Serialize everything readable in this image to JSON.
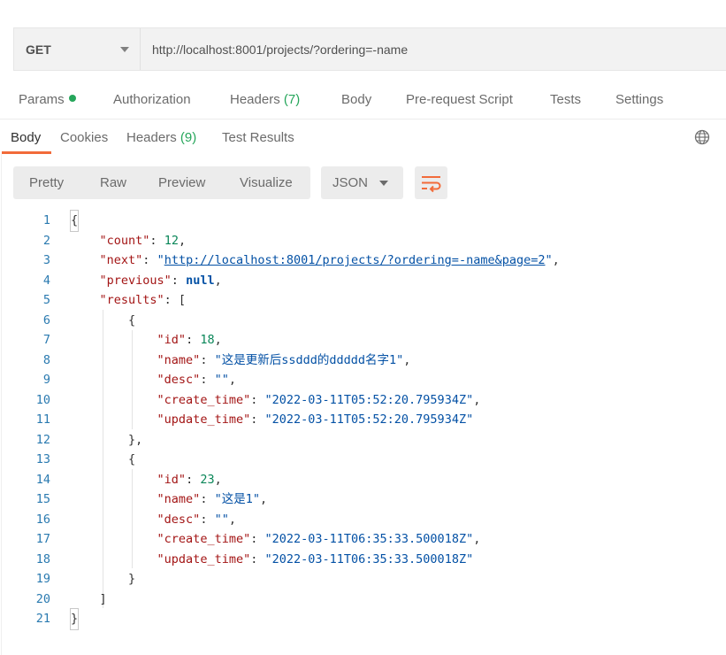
{
  "request": {
    "method": "GET",
    "url": "http://localhost:8001/projects/?ordering=-name"
  },
  "request_tabs": [
    {
      "label": "Params"
    },
    {
      "label": "Authorization"
    },
    {
      "label": "Headers",
      "count": "(7)"
    },
    {
      "label": "Body"
    },
    {
      "label": "Pre-request Script"
    },
    {
      "label": "Tests"
    },
    {
      "label": "Settings"
    }
  ],
  "response_tabs": [
    {
      "label": "Body"
    },
    {
      "label": "Cookies"
    },
    {
      "label": "Headers",
      "count": "(9)"
    },
    {
      "label": "Test Results"
    }
  ],
  "view_modes": [
    "Pretty",
    "Raw",
    "Preview",
    "Visualize"
  ],
  "format": "JSON",
  "icons": {
    "globe": "globe-icon",
    "wrap": "wrap-lines-icon"
  },
  "colors": {
    "accent": "#f26b3a",
    "count_green": "#26a65b",
    "line_number": "#2a7ab0",
    "json_key": "#a31515",
    "json_string": "#0451a5",
    "json_number": "#098658"
  },
  "response_body": {
    "count": "12",
    "next": "http://localhost:8001/projects/?ordering=-name&page=2",
    "previous": "null",
    "results": [
      {
        "id": "18",
        "name": "这是更新后ssddd的ddddd名字1",
        "desc": "",
        "create_time": "2022-03-11T05:52:20.795934Z",
        "update_time": "2022-03-11T05:52:20.795934Z"
      },
      {
        "id": "23",
        "name": "这是1",
        "desc": "",
        "create_time": "2022-03-11T06:35:33.500018Z",
        "update_time": "2022-03-11T06:35:33.500018Z"
      }
    ]
  },
  "line_numbers": [
    "1",
    "2",
    "3",
    "4",
    "5",
    "6",
    "7",
    "8",
    "9",
    "10",
    "11",
    "12",
    "13",
    "14",
    "15",
    "16",
    "17",
    "18",
    "19",
    "20",
    "21"
  ]
}
